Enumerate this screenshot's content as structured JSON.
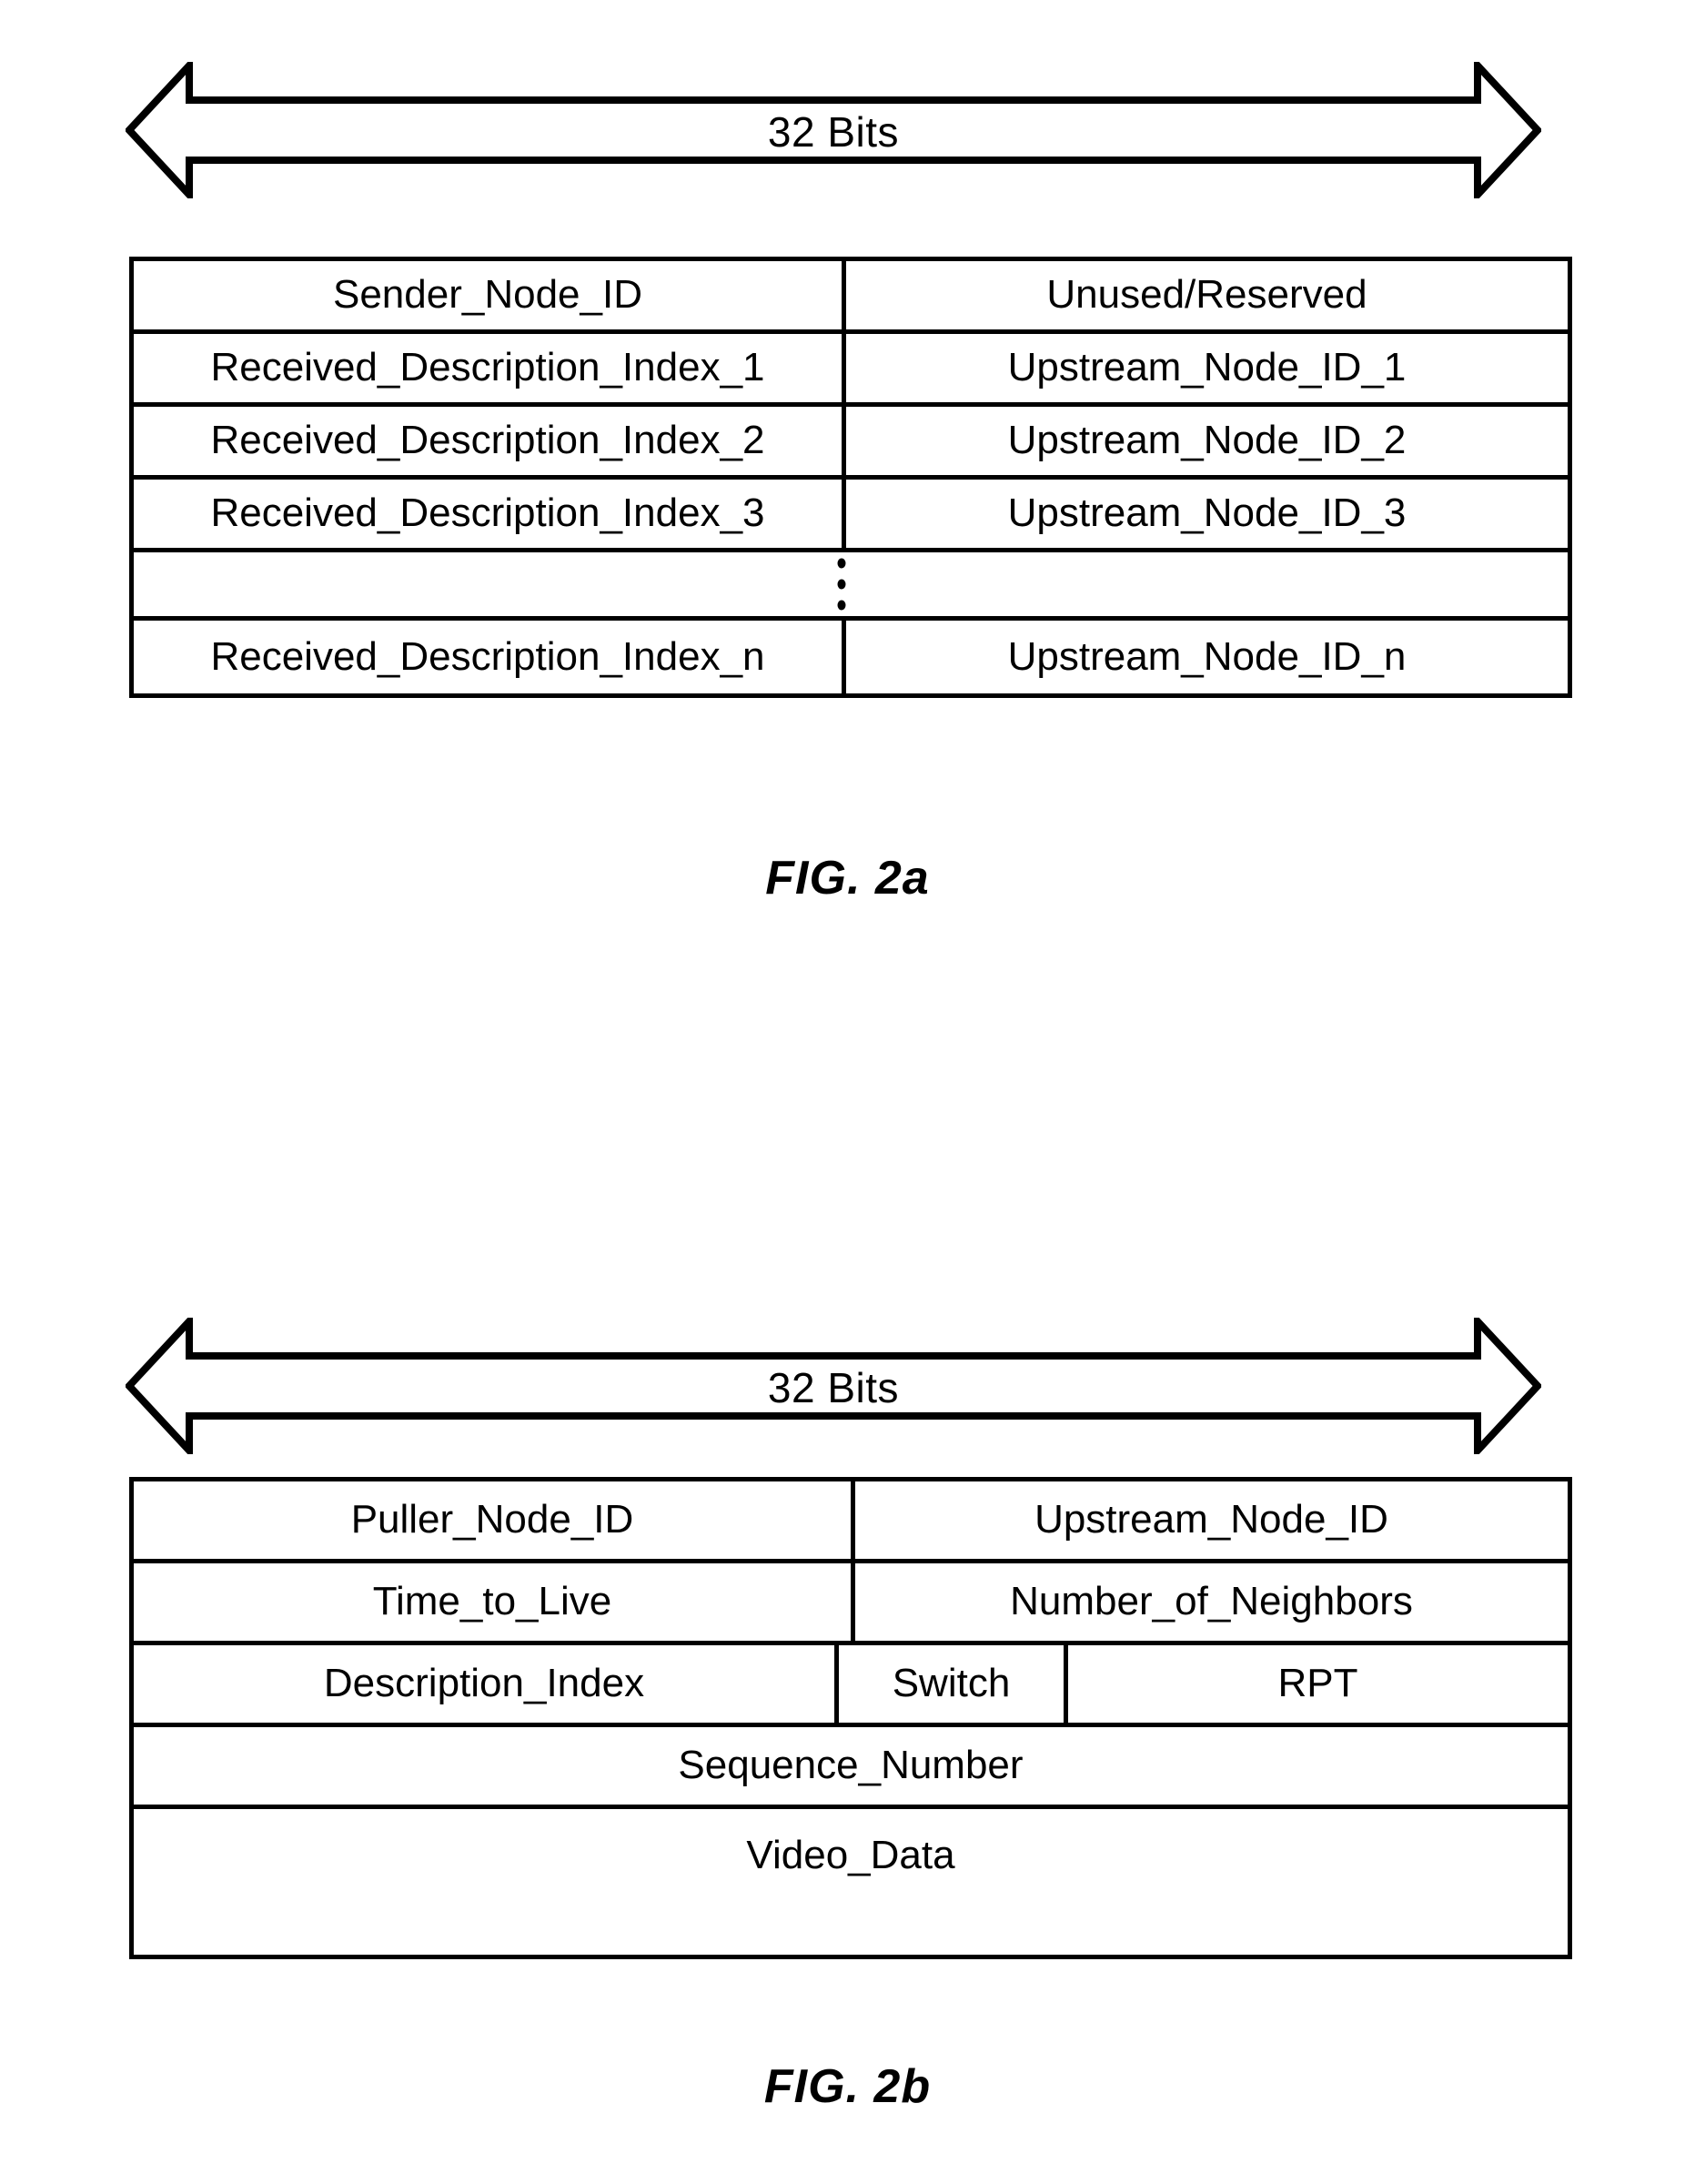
{
  "figures": [
    {
      "id": "fig2a",
      "caption": "FIG. 2a",
      "width_arrow_label": "32 Bits",
      "rows": [
        {
          "cells": [
            "Sender_Node_ID",
            "Unused/Reserved"
          ]
        },
        {
          "cells": [
            "Received_Description_Index_1",
            "Upstream_Node_ID_1"
          ]
        },
        {
          "cells": [
            "Received_Description_Index_2",
            "Upstream_Node_ID_2"
          ]
        },
        {
          "cells": [
            "Received_Description_Index_3",
            "Upstream_Node_ID_3"
          ]
        },
        {
          "cells": [
            ""
          ],
          "type": "ellipsis"
        },
        {
          "cells": [
            "Received_Description_Index_n",
            "Upstream_Node_ID_n"
          ]
        }
      ]
    },
    {
      "id": "fig2b",
      "caption": "FIG. 2b",
      "width_arrow_label": "32 Bits",
      "rows": [
        {
          "cells": [
            "Puller_Node_ID",
            "Upstream_Node_ID"
          ]
        },
        {
          "cells": [
            "Time_to_Live",
            "Number_of_Neighbors"
          ]
        },
        {
          "cells": [
            "Description_Index",
            "Switch",
            "RPT"
          ]
        },
        {
          "cells": [
            "Sequence_Number"
          ]
        },
        {
          "cells": [
            "Video_Data"
          ]
        }
      ]
    }
  ],
  "colors": {
    "line": "#000000",
    "background": "#ffffff"
  }
}
